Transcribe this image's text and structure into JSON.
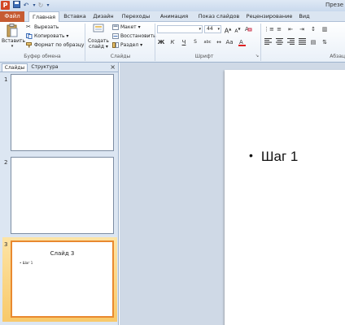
{
  "titlebar": {
    "app_icon": "powerpoint-logo",
    "app_letter": "P",
    "title": "Презе"
  },
  "tabs": {
    "file": "Файл",
    "items": [
      "Главная",
      "Вставка",
      "Дизайн",
      "Переходы",
      "Анимация",
      "Показ слайдов",
      "Рецензирование",
      "Вид"
    ],
    "active": "Главная"
  },
  "ribbon": {
    "clipboard": {
      "paste": "Вставить",
      "cut": "Вырезать",
      "copy": "Копировать",
      "format_painter": "Формат по образцу",
      "group_label": "Буфер обмена"
    },
    "slides": {
      "new_slide_1": "Создать",
      "new_slide_2": "слайд",
      "layout": "Макет",
      "reset": "Восстановить",
      "section": "Раздел",
      "group_label": "Слайды"
    },
    "font": {
      "size": "44",
      "bold": "Ж",
      "italic": "К",
      "underline": "Ч",
      "strike": "S",
      "spacing": "abc",
      "group_label": "Шрифт"
    },
    "paragraph": {
      "group_label": "Абзац"
    }
  },
  "left_panel": {
    "tab_slides": "Слайды",
    "tab_outline": "Структура",
    "close": "×",
    "thumbnails": [
      {
        "number": "1",
        "title": "",
        "bullet": ""
      },
      {
        "number": "2",
        "title": "",
        "bullet": ""
      },
      {
        "number": "3",
        "title": "Слайд 3",
        "bullet": "• Шаг 1"
      }
    ]
  },
  "slide": {
    "bullet_text": "Шаг 1"
  },
  "colors": {
    "file_tab": "#c65b32",
    "selection": "#e9892f",
    "ribbon_bg": "#e9f0f8"
  }
}
